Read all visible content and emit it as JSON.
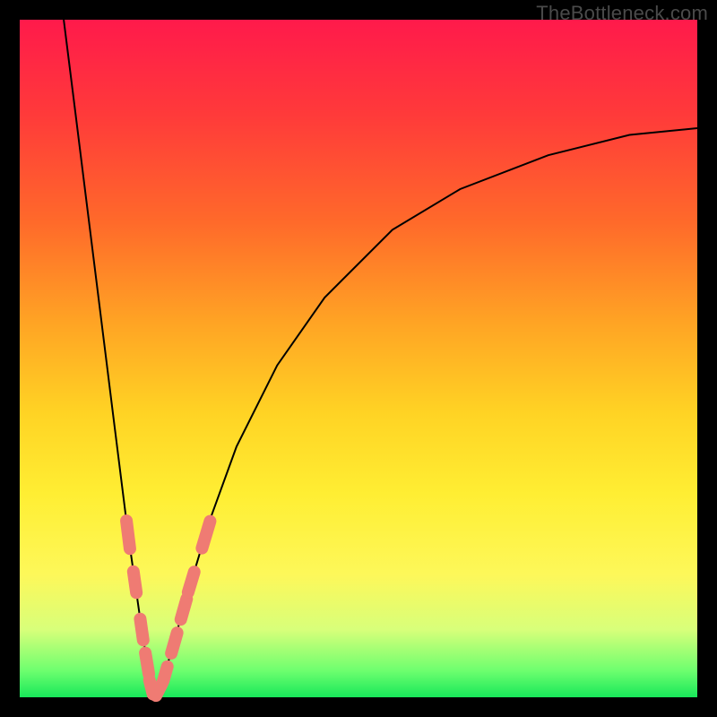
{
  "watermark": "TheBottleneck.com",
  "chart_data": {
    "type": "line",
    "title": "",
    "xlabel": "",
    "ylabel": "",
    "xlim": [
      0,
      100
    ],
    "ylim": [
      0,
      100
    ],
    "grid": false,
    "background_gradient": {
      "orientation": "vertical",
      "stops": [
        {
          "pos": 0.0,
          "color": "#ff1a4b"
        },
        {
          "pos": 0.14,
          "color": "#ff3a3a"
        },
        {
          "pos": 0.3,
          "color": "#ff6a2a"
        },
        {
          "pos": 0.45,
          "color": "#ffa524"
        },
        {
          "pos": 0.58,
          "color": "#ffd324"
        },
        {
          "pos": 0.7,
          "color": "#ffee33"
        },
        {
          "pos": 0.82,
          "color": "#fdf85a"
        },
        {
          "pos": 0.9,
          "color": "#d8ff7a"
        },
        {
          "pos": 0.96,
          "color": "#6fff6f"
        },
        {
          "pos": 1.0,
          "color": "#18e85a"
        }
      ]
    },
    "curve": {
      "description": "V-shaped bottleneck curve; minimum near x≈20, steep left arm, shallow right arm",
      "min_x": 20,
      "min_y": 0,
      "points": [
        {
          "x": 6.5,
          "y": 100
        },
        {
          "x": 8,
          "y": 88
        },
        {
          "x": 10,
          "y": 72
        },
        {
          "x": 12,
          "y": 56
        },
        {
          "x": 14,
          "y": 40
        },
        {
          "x": 16,
          "y": 24
        },
        {
          "x": 18,
          "y": 10
        },
        {
          "x": 19,
          "y": 4
        },
        {
          "x": 20,
          "y": 0
        },
        {
          "x": 21,
          "y": 2
        },
        {
          "x": 23,
          "y": 9
        },
        {
          "x": 25,
          "y": 16
        },
        {
          "x": 28,
          "y": 26
        },
        {
          "x": 32,
          "y": 37
        },
        {
          "x": 38,
          "y": 49
        },
        {
          "x": 45,
          "y": 59
        },
        {
          "x": 55,
          "y": 69
        },
        {
          "x": 65,
          "y": 75
        },
        {
          "x": 78,
          "y": 80
        },
        {
          "x": 90,
          "y": 83
        },
        {
          "x": 100,
          "y": 84
        }
      ]
    },
    "markers": {
      "color": "#ef7b73",
      "shape": "rounded-capsule",
      "points": [
        {
          "x": 16,
          "y": 24,
          "len": 6
        },
        {
          "x": 17,
          "y": 17,
          "len": 5
        },
        {
          "x": 18,
          "y": 10,
          "len": 5
        },
        {
          "x": 18.8,
          "y": 5,
          "len": 5
        },
        {
          "x": 19.4,
          "y": 1.5,
          "len": 4
        },
        {
          "x": 20.6,
          "y": 1.2,
          "len": 4
        },
        {
          "x": 21.5,
          "y": 3.5,
          "len": 4
        },
        {
          "x": 22.8,
          "y": 8,
          "len": 5
        },
        {
          "x": 24.2,
          "y": 13,
          "len": 5
        },
        {
          "x": 25.3,
          "y": 17,
          "len": 5
        },
        {
          "x": 27.5,
          "y": 24,
          "len": 6
        }
      ]
    }
  }
}
